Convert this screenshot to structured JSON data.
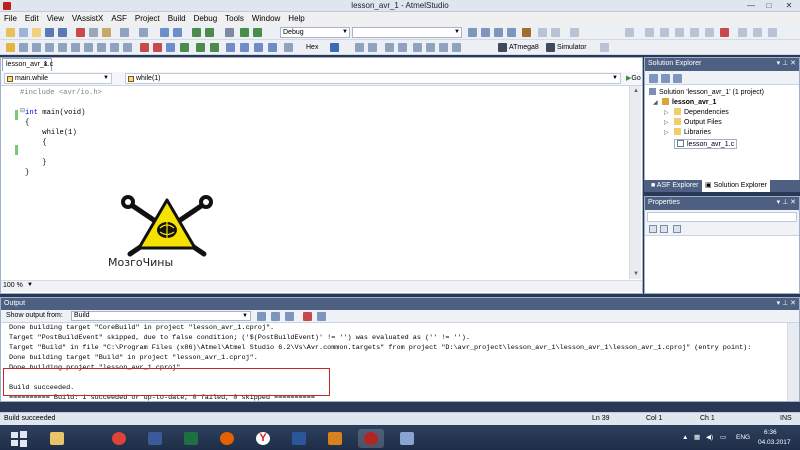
{
  "window": {
    "title": "lesson_avr_1 - AtmelStudio",
    "minimize": "—",
    "maximize": "□",
    "close": "✕"
  },
  "menu": [
    "File",
    "Edit",
    "View",
    "VAssistX",
    "ASF",
    "Project",
    "Build",
    "Debug",
    "Tools",
    "Window",
    "Help"
  ],
  "toolbar": {
    "config": "Debug",
    "platform": "",
    "hex_label": "Hex",
    "device": "ATmega8",
    "simulator": "Simulator"
  },
  "editor": {
    "tab": "lesson_avr_1.c",
    "nav_left": "main.while",
    "nav_right": "while(1)",
    "go": "Go",
    "zoom": "100 %",
    "lines": [
      {
        "pp": "#include <avr/io.h>",
        "kw": "",
        "text": ""
      },
      {
        "pp": "",
        "kw": "",
        "text": ""
      },
      {
        "pp": "",
        "kw": "int",
        "text": " main(void)"
      },
      {
        "pp": "",
        "kw": "",
        "text": "{"
      },
      {
        "pp": "",
        "kw": "",
        "text": "    while(1)"
      },
      {
        "pp": "",
        "kw": "",
        "text": "    {"
      },
      {
        "pp": "",
        "kw": "",
        "text": ""
      },
      {
        "pp": "",
        "kw": "",
        "text": "    }"
      },
      {
        "pp": "",
        "kw": "",
        "text": "}"
      }
    ]
  },
  "logo": {
    "text": "МозгоЧины"
  },
  "solution_explorer": {
    "title": "Solution Explorer",
    "items": [
      {
        "label": "Solution 'lesson_avr_1' (1 project)",
        "icon": "solution-icon"
      },
      {
        "label": "lesson_avr_1",
        "icon": "project-icon"
      },
      {
        "label": "Dependencies",
        "icon": "folder-icon"
      },
      {
        "label": "Output Files",
        "icon": "folder-icon"
      },
      {
        "label": "Libraries",
        "icon": "folder-icon"
      },
      {
        "label": "lesson_avr_1.c",
        "icon": "c-file-icon"
      }
    ],
    "tabs": [
      "ASF Explorer",
      "Solution Explorer"
    ]
  },
  "properties": {
    "title": "Properties"
  },
  "output": {
    "title": "Output",
    "show_from_label": "Show output from:",
    "show_from_value": "Build",
    "lines": [
      "Done building target \"CoreBuild\" in project \"lesson_avr_1.cproj\".",
      "Target \"PostBuildEvent\" skipped, due to false condition; ('$(PostBuildEvent)' != '') was evaluated as ('' != '').",
      "Target \"Build\" in file \"C:\\Program Files (x86)\\Atmel\\Atmel Studio 6.2\\Vs\\Avr.common.targets\" from project \"D:\\avr_project\\lesson_avr_1\\lesson_avr_1\\lesson_avr_1.cproj\" (entry point):",
      "Done building target \"Build\" in project \"lesson_avr_1.cproj\".",
      "Done building project \"lesson_avr_1.cproj\".",
      "",
      "Build succeeded.",
      "========== Build: 1 succeeded or up-to-date, 0 failed, 0 skipped =========="
    ]
  },
  "status": {
    "message": "Build succeeded",
    "ln": "Ln 39",
    "col": "Col 1",
    "ch": "Ch 1",
    "ins": "INS"
  },
  "taskbar": {
    "apps": [
      "start-icon",
      "explorer-icon",
      "chrome-icon",
      "save-app-icon",
      "excel-icon",
      "firefox-icon",
      "yandex-icon",
      "word-icon",
      "media-icon",
      "atmel-studio-icon",
      "tool-icon"
    ],
    "lang": "ENG",
    "time": "6:36",
    "date": "04.03.2017"
  },
  "colors": {
    "accent": "#4d6082",
    "highlight_box": "#c62828",
    "logo_yellow": "#f5e200"
  }
}
